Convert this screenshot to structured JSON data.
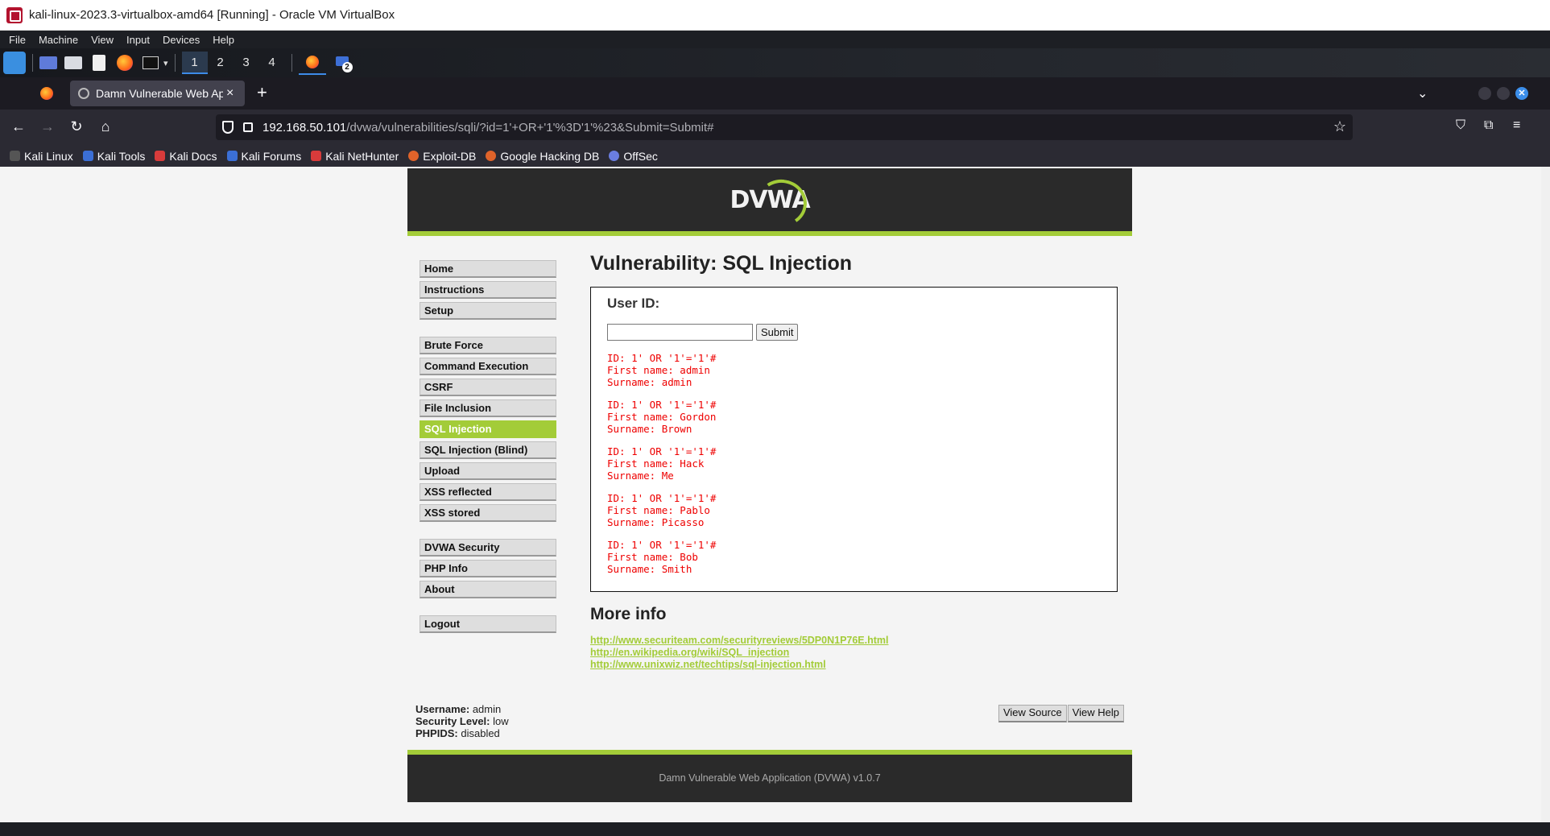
{
  "vbox": {
    "title": "kali-linux-2023.3-virtualbox-amd64 [Running] - Oracle VM VirtualBox",
    "menus": [
      "File",
      "Machine",
      "View",
      "Input",
      "Devices",
      "Help"
    ]
  },
  "panel": {
    "workspaces": [
      "1",
      "2",
      "3",
      "4"
    ],
    "active_workspace": "1",
    "badge": "2"
  },
  "browser": {
    "tab_title": "Damn Vulnerable Web Ap",
    "tab_close": "×",
    "new_tab": "+",
    "url_host": "192.168.50.101",
    "url_path": "/dvwa/vulnerabilities/sqli/?id=1'+OR+'1'%3D'1'%23&Submit=Submit#",
    "bookmarks": [
      {
        "label": "Kali Linux",
        "color": "#2b2a33"
      },
      {
        "label": "Kali Tools",
        "color": "#3b6fd6"
      },
      {
        "label": "Kali Docs",
        "color": "#d83b3b"
      },
      {
        "label": "Kali Forums",
        "color": "#3b6fd6"
      },
      {
        "label": "Kali NetHunter",
        "color": "#d83b3b"
      },
      {
        "label": "Exploit-DB",
        "color": "#e0632a"
      },
      {
        "label": "Google Hacking DB",
        "color": "#e0632a"
      },
      {
        "label": "OffSec",
        "color": "#6a7de0"
      }
    ]
  },
  "dvwa": {
    "logo": "DVWA",
    "nav_group1": [
      "Home",
      "Instructions",
      "Setup"
    ],
    "nav_group2": [
      "Brute Force",
      "Command Execution",
      "CSRF",
      "File Inclusion",
      "SQL Injection",
      "SQL Injection (Blind)",
      "Upload",
      "XSS reflected",
      "XSS stored"
    ],
    "nav_group3": [
      "DVWA Security",
      "PHP Info",
      "About"
    ],
    "nav_group4": [
      "Logout"
    ],
    "selected_nav": "SQL Injection",
    "page_title": "Vulnerability: SQL Injection",
    "userid_label": "User ID:",
    "submit_label": "Submit",
    "userid_value": "",
    "results": [
      {
        "id": "ID: 1' OR '1'='1'#",
        "first": "First name: admin",
        "sur": "Surname: admin"
      },
      {
        "id": "ID: 1' OR '1'='1'#",
        "first": "First name: Gordon",
        "sur": "Surname: Brown"
      },
      {
        "id": "ID: 1' OR '1'='1'#",
        "first": "First name: Hack",
        "sur": "Surname: Me"
      },
      {
        "id": "ID: 1' OR '1'='1'#",
        "first": "First name: Pablo",
        "sur": "Surname: Picasso"
      },
      {
        "id": "ID: 1' OR '1'='1'#",
        "first": "First name: Bob",
        "sur": "Surname: Smith"
      }
    ],
    "more_info_title": "More info",
    "links": [
      "http://www.securiteam.com/securityreviews/5DP0N1P76E.html",
      "http://en.wikipedia.org/wiki/SQL_injection",
      "http://www.unixwiz.net/techtips/sql-injection.html"
    ],
    "user_info": {
      "username_label": "Username:",
      "username": "admin",
      "security_label": "Security Level:",
      "security": "low",
      "phpids_label": "PHPIDS:",
      "phpids": "disabled"
    },
    "view_source": "View Source",
    "view_help": "View Help",
    "footer": "Damn Vulnerable Web Application (DVWA) v1.0.7",
    "accent_color": "#a3cc38"
  }
}
